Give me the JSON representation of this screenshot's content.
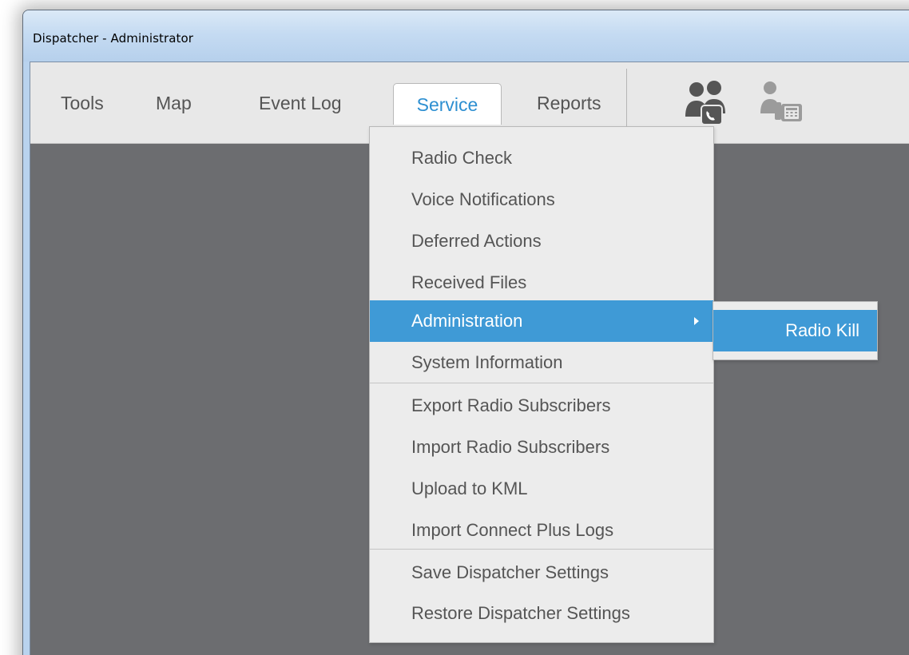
{
  "window": {
    "title": "Dispatcher - Administrator"
  },
  "menubar": {
    "items": [
      {
        "label": "Tools"
      },
      {
        "label": "Map"
      },
      {
        "label": "Event Log"
      },
      {
        "label": "Service"
      },
      {
        "label": "Reports"
      }
    ],
    "active": "Service",
    "accent_color": "#2d8fd1",
    "toolbar_icons": [
      "dispatcher-call-icon",
      "phone-console-icon"
    ]
  },
  "service_menu": {
    "items": [
      {
        "label": "Radio Check"
      },
      {
        "label": "Voice Notifications"
      },
      {
        "label": "Deferred Actions"
      },
      {
        "label": "Received Files"
      },
      {
        "label": "Administration",
        "has_submenu": true,
        "highlighted": true
      },
      {
        "label": "System Information"
      },
      {
        "label": "Export Radio Subscribers"
      },
      {
        "label": "Import Radio Subscribers"
      },
      {
        "label": "Upload to KML"
      },
      {
        "label": "Import Connect Plus Logs"
      },
      {
        "label": "Save Dispatcher Settings"
      },
      {
        "label": "Restore Dispatcher Settings"
      }
    ],
    "highlight_color": "#3f9ad6"
  },
  "administration_submenu": {
    "items": [
      {
        "label": "Radio Kill"
      }
    ]
  }
}
